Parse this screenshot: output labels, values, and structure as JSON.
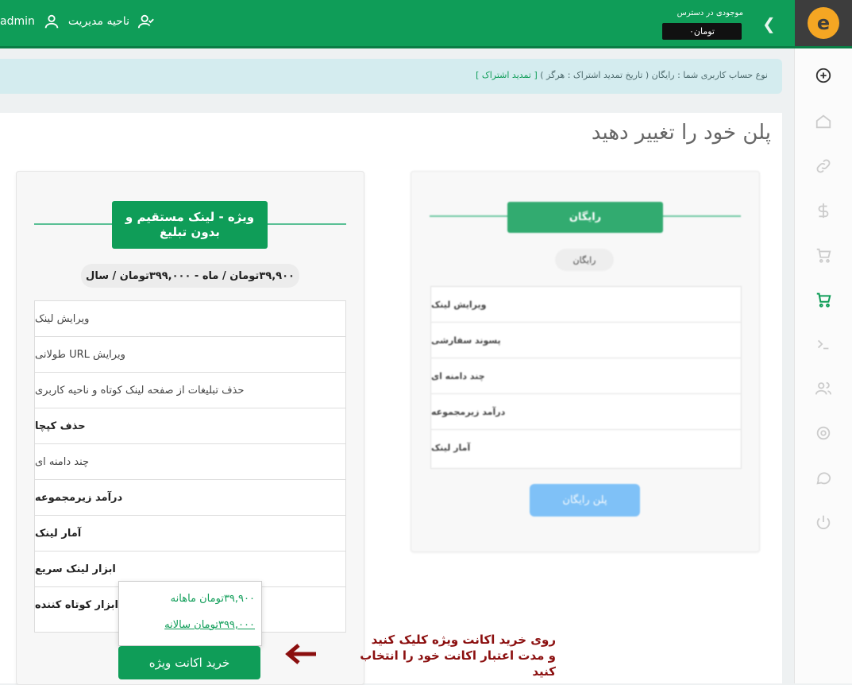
{
  "header": {
    "balance_label": "موجودی در دسترس",
    "balance_value": "۰تومان",
    "management_area": "ناحیه مدیریت",
    "username": "admin"
  },
  "sidebar": {
    "icons": [
      "add-icon",
      "home-icon",
      "link-icon",
      "dollar-icon",
      "cart-icon",
      "cart-active-icon",
      "terminal-icon",
      "users-icon",
      "settings-icon",
      "chat-icon",
      "power-icon"
    ]
  },
  "info_bar": {
    "text": "نوع حساب کاربری شما : رایگان ( تاریخ تمدید اشتراک : هرگز )",
    "renew_link": "[ تمدید اشتراک ]"
  },
  "page": {
    "title": "پلن خود را تغییر دهید"
  },
  "plans": {
    "vip": {
      "title": "ویژه - لینک مستقیم و بدون تبلیغ",
      "price": "۳۹,۹۰۰تومان / ماه - ۳۹۹,۰۰۰تومان / سال",
      "features": [
        {
          "label": "ویرایش لینک",
          "bold": false
        },
        {
          "label": "ویرایش URL طولانی",
          "bold": false
        },
        {
          "label": "حذف تبلیغات از صفحه لینک کوتاه و ناحیه کاربری",
          "bold": false
        },
        {
          "label": "حذف کپچا",
          "bold": true
        },
        {
          "label": "چند دامنه ای",
          "bold": false
        },
        {
          "label": "درآمد زیرمجموعه",
          "bold": true
        },
        {
          "label": "آمار لینک",
          "bold": true
        },
        {
          "label": "ابزار لینک سریع",
          "bold": true
        },
        {
          "label": "ابزار کوتاه کننده",
          "bold": true
        }
      ],
      "buy_button": "خرید اکانت ویژه",
      "popup_options": [
        "۳۹,۹۰۰تومان ماهانه",
        "۳۹۹,۰۰۰تومان سالانه"
      ]
    },
    "free": {
      "title": "رایگان",
      "price": "رایگان",
      "features": [
        "ویرایش لینک",
        "پسوند سفارشی",
        "چند دامنه ای",
        "درآمد زیرمجموعه",
        "آمار لینک"
      ],
      "button": "پلن رایگان"
    }
  },
  "annotation": {
    "line1": "روی خرید اکانت ویژه کلیک کنید",
    "line2": "و مدت اعتبار اکانت خود را انتخاب کنید"
  },
  "colors": {
    "brand_green": "#0f9d58",
    "free_button_blue": "#6ab8f7",
    "annotation_red": "#8b0f0f",
    "logo_orange": "#f5a623"
  }
}
